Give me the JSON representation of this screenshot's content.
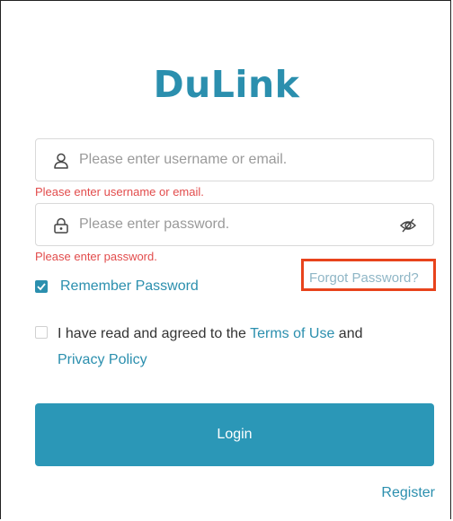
{
  "brand": {
    "logo_text": "DuLink",
    "color": "#2b8fae"
  },
  "username": {
    "placeholder": "Please enter username or email.",
    "value": "",
    "error": "Please enter username or email.",
    "icon": "user-icon"
  },
  "password": {
    "placeholder": "Please enter password.",
    "value": "",
    "error": "Please enter password.",
    "icon": "lock-icon",
    "toggle_icon": "eye-off-icon"
  },
  "remember": {
    "label": "Remember Password",
    "checked": true
  },
  "forgot": {
    "label": "Forgot Password?",
    "highlight_color": "#e8431c"
  },
  "terms": {
    "checked": false,
    "prefix": "I have read and agreed to the ",
    "terms_link": "Terms of Use",
    "middle": " and",
    "privacy_link": "Privacy Policy"
  },
  "login": {
    "label": "Login",
    "color": "#2b97b7"
  },
  "register": {
    "label": "Register"
  },
  "error_color": "#e24c4c"
}
